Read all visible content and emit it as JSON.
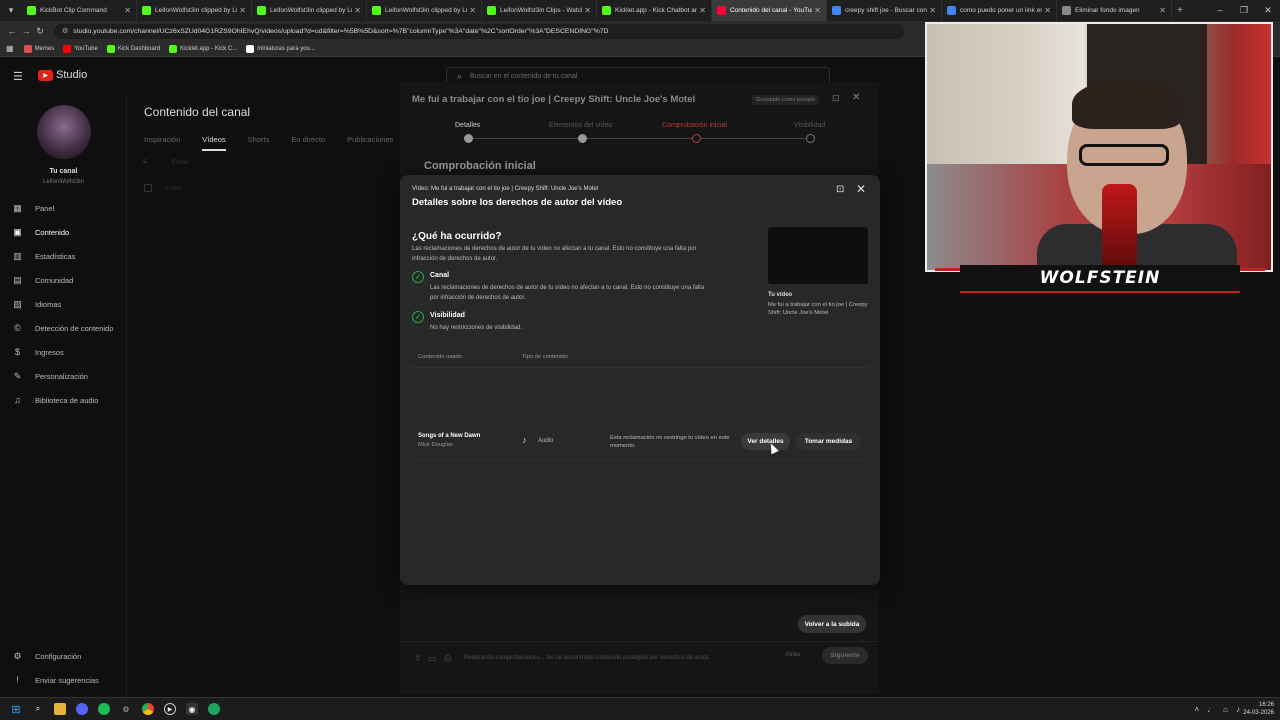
{
  "browser": {
    "tabs": [
      {
        "label": "KickBot Clip Command",
        "color": "#53fc18"
      },
      {
        "label": "LeifonWolfst3in clipped by Lu",
        "color": "#53fc18"
      },
      {
        "label": "LeifonWolfst3in clipped by Lu",
        "color": "#53fc18"
      },
      {
        "label": "LeifonWolfst3in clipped by Lu",
        "color": "#53fc18"
      },
      {
        "label": "LeifonWolfst3in Clips - Watch",
        "color": "#53fc18"
      },
      {
        "label": "Kicklet.app - Kick Chatbot and",
        "color": "#53fc18"
      },
      {
        "label": "Contenido del canal - YouTub",
        "color": "#ff0033"
      },
      {
        "label": "creepy shift joe - Buscar con G",
        "color": "#4285f4"
      },
      {
        "label": "como puedo poner un link en",
        "color": "#4285f4"
      },
      {
        "label": "Eliminar fondo imagen",
        "color": "#888888"
      }
    ],
    "url": "studio.youtube.com/channel/UCz6xSZUd04G1RZS9OhIEhvQ/videos/upload?d=ud&filter=%5B%5D&sort=%7B\"columnType\"%3A\"date\"%2C\"sortOrder\"%3A\"DESCENDING\"%7D",
    "bookmarks": [
      "Memes",
      "YouTube",
      "Kick Dashboard",
      "Kicklet.app - Kick C...",
      "miniaturas para you..."
    ]
  },
  "studio": {
    "logo": "Studio",
    "search_placeholder": "Buscar en el contenido de tu canal",
    "channel_name": "Tu canal",
    "channel_handle": "LeifonWolfst3in",
    "nav": [
      "Panel",
      "Contenido",
      "Estadísticas",
      "Comunidad",
      "Idiomas",
      "Detección de contenido",
      "Ingresos",
      "Personalización",
      "Biblioteca de audio"
    ],
    "nav_bottom": [
      "Configuración",
      "Enviar sugerencias"
    ],
    "page_title": "Contenido del canal",
    "content_tabs": [
      "Inspiración",
      "Vídeos",
      "Shorts",
      "En directo",
      "Publicaciones"
    ],
    "filter_text": "Filtrar",
    "video_col": "Vídeo"
  },
  "upload": {
    "title": "Me fui a trabajar con el tio joe | Creepy Shift: Uncle Joe's Motel",
    "saved": "Guardado como privado",
    "steps": [
      "Detalles",
      "Elementos del vídeo",
      "Comprobación inicial",
      "Visibilidad"
    ],
    "heading": "Comprobación inicial",
    "footer_text": "Realizando comprobaciones... Se ha encontrado contenido protegido por derechos de autor.",
    "back": "Atrás",
    "next": "Siguiente"
  },
  "modal": {
    "subtitle": "Vídeo: Me fui a trabajar con el tio joe | Creepy Shift: Uncle Joe's Motel",
    "title": "Detalles sobre los derechos de autor del vídeo",
    "what_happened": "¿Qué ha ocurrido?",
    "description": "Las reclamaciones de derechos de autor de tu vídeo no afectan a tu canal. Esto no constituye una falta por infracción de derechos de autor.",
    "checks": [
      {
        "title": "Canal",
        "text": "Las reclamaciones de derechos de autor de tu vídeo no afectan a tu canal. Esto no constituye una falta por infracción de derechos de autor."
      },
      {
        "title": "Visibilidad",
        "text": "No hay restricciones de visibilidad."
      }
    ],
    "your_video_label": "Tu vídeo",
    "your_video_title": "Me fui a trabajar con el tio joe | Creepy Shift: Uncle Joe's Motel",
    "columns": [
      "Contenido usado",
      "Tipo de contenido"
    ],
    "claim": {
      "song": "Songs of a New Dawn",
      "artist": "Mick Douglas",
      "type": "Audio",
      "note": "Esta reclamación no restringe tu vídeo en este momento.",
      "details_btn": "Ver detalles",
      "action_btn": "Tomar medidas"
    },
    "return_btn": "Volver a la subida"
  },
  "overlay": {
    "banner": "WOLFSTEIN"
  },
  "clock": {
    "time": "16:26",
    "date": "24-03-2026"
  }
}
